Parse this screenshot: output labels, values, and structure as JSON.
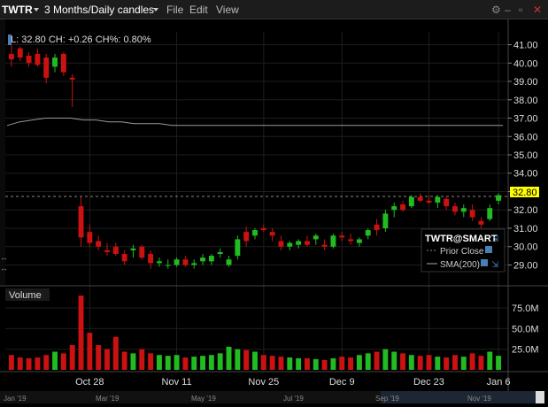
{
  "titlebar": {
    "symbol": "TWTR",
    "period": "3 Months/Daily candles",
    "menu_file": "File",
    "menu_edit": "Edit",
    "menu_view": "View",
    "icons": [
      "gear-icon",
      "minimize-icon",
      "restore-icon",
      "close-icon"
    ]
  },
  "info_line": "L: 32.80  CH: +0.26  CH%: 0.80%",
  "legend": {
    "title": "TWTR@SMART",
    "items": [
      "Prior Close",
      "SMA(200)"
    ]
  },
  "last_price": "32.80",
  "volume_label": "Volume",
  "colors": {
    "up": "#22bb22",
    "down": "#cc1111",
    "sma": "#aaaaaa",
    "last_bg": "#ffff00",
    "grid": "#1e1e1e"
  },
  "chart_data": {
    "type": "candlestick",
    "price_ticks": [
      "41.00",
      "40.00",
      "39.00",
      "38.00",
      "37.00",
      "36.00",
      "35.00",
      "34.00",
      "33.00",
      "32.00",
      "31.00",
      "30.00",
      "29.00"
    ],
    "volume_ticks": [
      "75.0M",
      "50.0M",
      "25.0M"
    ],
    "date_ticks": [
      "Oct 28",
      "Nov 11",
      "Nov 25",
      "Dec 9",
      "Dec 23",
      "Jan 6"
    ],
    "nav_ticks": [
      "Jan '19",
      "Mar '19",
      "May '19",
      "Jul '19",
      "Sep '19",
      "Nov '19"
    ],
    "sma200": [
      36.6,
      36.8,
      36.9,
      37.0,
      37.0,
      37.0,
      36.9,
      36.9,
      36.8,
      36.8,
      36.7,
      36.7,
      36.7,
      36.6,
      36.6,
      36.6,
      36.6,
      36.6,
      36.6,
      36.6,
      36.6,
      36.6,
      36.6,
      36.6,
      36.6,
      36.6,
      36.6,
      36.6,
      36.6,
      36.6,
      36.6,
      36.6,
      36.6,
      36.6,
      36.6,
      36.6,
      36.6,
      36.6,
      36.6,
      36.6
    ],
    "candles": [
      [
        40.5,
        41.0,
        39.8,
        40.2,
        18
      ],
      [
        40.8,
        40.9,
        40.1,
        40.3,
        15
      ],
      [
        40.4,
        40.6,
        39.8,
        40.0,
        14
      ],
      [
        40.5,
        40.8,
        39.8,
        39.9,
        15
      ],
      [
        40.3,
        40.5,
        38.9,
        39.2,
        18
      ],
      [
        39.8,
        40.5,
        39.5,
        40.3,
        22
      ],
      [
        40.5,
        40.6,
        39.3,
        39.5,
        20
      ],
      [
        39.2,
        39.4,
        37.6,
        39.1,
        30
      ],
      [
        32.2,
        32.7,
        30.0,
        30.5,
        90
      ],
      [
        30.8,
        31.2,
        30.0,
        30.2,
        45
      ],
      [
        30.3,
        30.6,
        29.8,
        30.0,
        30
      ],
      [
        29.8,
        30.2,
        29.5,
        29.7,
        25
      ],
      [
        30.0,
        30.2,
        29.5,
        29.6,
        40
      ],
      [
        29.6,
        29.8,
        29.0,
        29.2,
        22
      ],
      [
        29.8,
        30.1,
        29.4,
        29.9,
        20
      ],
      [
        30.0,
        30.1,
        29.3,
        29.4,
        25
      ],
      [
        29.6,
        29.8,
        28.8,
        29.1,
        20
      ],
      [
        29.1,
        29.4,
        28.9,
        29.2,
        18
      ],
      [
        29.0,
        29.3,
        28.8,
        29.0,
        17
      ],
      [
        29.0,
        29.4,
        28.9,
        29.3,
        18
      ],
      [
        29.3,
        29.5,
        28.9,
        29.0,
        15
      ],
      [
        29.0,
        29.3,
        28.8,
        29.1,
        16
      ],
      [
        29.2,
        29.6,
        29.0,
        29.4,
        17
      ],
      [
        29.2,
        29.6,
        29.0,
        29.5,
        18
      ],
      [
        29.6,
        29.9,
        29.4,
        29.7,
        20
      ],
      [
        29.0,
        29.5,
        28.9,
        29.3,
        28
      ],
      [
        29.5,
        30.6,
        29.3,
        30.4,
        25
      ],
      [
        30.8,
        31.1,
        30.0,
        30.3,
        24
      ],
      [
        30.6,
        31.0,
        30.4,
        30.9,
        22
      ],
      [
        31.0,
        31.2,
        30.8,
        30.9,
        18
      ],
      [
        30.8,
        31.0,
        30.3,
        30.6,
        17
      ],
      [
        30.3,
        30.6,
        29.8,
        30.0,
        16
      ],
      [
        30.0,
        30.3,
        29.8,
        30.2,
        15
      ],
      [
        30.1,
        30.4,
        29.9,
        30.3,
        14
      ],
      [
        30.3,
        30.6,
        30.0,
        30.1,
        14
      ],
      [
        30.4,
        30.7,
        30.1,
        30.6,
        13
      ],
      [
        30.1,
        30.4,
        29.8,
        30.0,
        12
      ],
      [
        30.0,
        30.7,
        29.9,
        30.6,
        14
      ],
      [
        30.6,
        30.8,
        30.3,
        30.5,
        16
      ],
      [
        30.4,
        30.7,
        30.1,
        30.3,
        15
      ],
      [
        30.2,
        30.5,
        30.0,
        30.4,
        18
      ],
      [
        30.6,
        31.0,
        30.4,
        30.9,
        20
      ],
      [
        31.2,
        31.5,
        30.6,
        30.9,
        22
      ],
      [
        31.0,
        32.0,
        30.8,
        31.8,
        25
      ],
      [
        32.0,
        32.4,
        31.6,
        32.2,
        22
      ],
      [
        32.3,
        32.5,
        31.9,
        32.0,
        20
      ],
      [
        32.2,
        32.8,
        32.1,
        32.7,
        18
      ],
      [
        32.7,
        32.9,
        32.4,
        32.5,
        17
      ],
      [
        32.5,
        32.8,
        32.3,
        32.4,
        18
      ],
      [
        32.4,
        32.8,
        32.1,
        32.7,
        16
      ],
      [
        32.6,
        32.7,
        32.0,
        32.2,
        15
      ],
      [
        32.2,
        32.4,
        31.7,
        31.9,
        18
      ],
      [
        31.9,
        32.3,
        31.6,
        32.1,
        16
      ],
      [
        32.0,
        32.3,
        31.4,
        31.6,
        20
      ],
      [
        31.4,
        31.6,
        31.0,
        31.2,
        17
      ],
      [
        31.5,
        32.3,
        31.4,
        32.1,
        22
      ],
      [
        32.5,
        32.9,
        32.3,
        32.8,
        17
      ]
    ],
    "ylim": [
      28.3,
      41.7
    ],
    "volume_max": 88
  }
}
